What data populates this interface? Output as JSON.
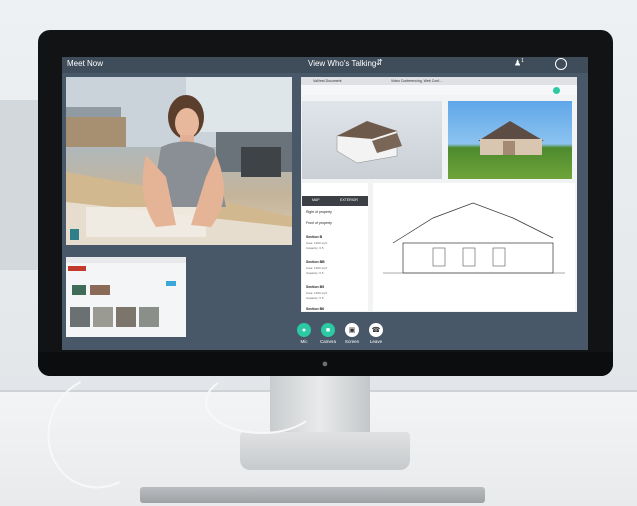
{
  "meeting": {
    "title": "Meet Now",
    "view_mode": "View Who's Talking",
    "participant_count": "1"
  },
  "browser": {
    "tab_1": "ValVest Document",
    "tab_2": "Video Conferencing, Web Conf..."
  },
  "side_panel": {
    "tabs": [
      "MAP",
      "EXTERIOR"
    ],
    "filters": [
      "Right of property",
      "Front of property"
    ],
    "sections": [
      {
        "title": "Section B",
        "lines": [
          "Area: 1200 sq ft",
          "Capacity: 0.5"
        ]
      },
      {
        "title": "Section BB",
        "lines": [
          "Area: 1200 sq ft",
          "Capacity: 0.5"
        ]
      },
      {
        "title": "Section B5",
        "lines": [
          "Area: 1200 sq ft",
          "Capacity: 0.5"
        ]
      },
      {
        "title": "Section B6",
        "lines": []
      }
    ]
  },
  "controls": {
    "mic": "Mic",
    "camera": "Camera",
    "screen": "Screen",
    "leave": "Leave"
  },
  "colors": {
    "accent_teal": "#2cc9a5",
    "screen_bg": "#485868",
    "leave_red": "#ffffff"
  }
}
